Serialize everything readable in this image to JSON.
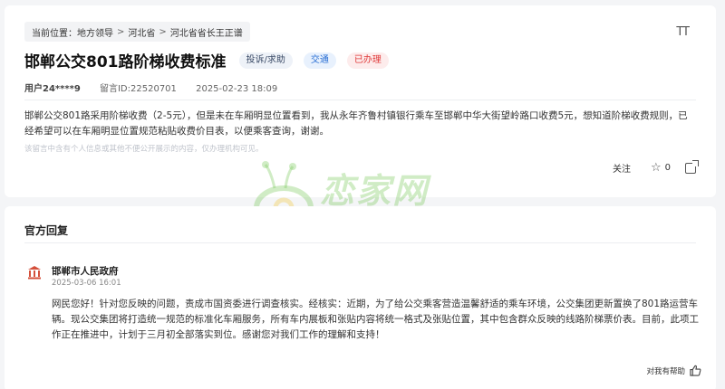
{
  "breadcrumb": {
    "prefix": "当前位置：",
    "items": [
      "地方领导",
      "河北省",
      "河北省省长王正谱"
    ],
    "separator": ">"
  },
  "font_toggle": "TT",
  "message": {
    "title": "邯郸公交801路阶梯收费标准",
    "tags": {
      "category": "投诉/求助",
      "type": "交通",
      "status": "已办理"
    },
    "user": "用户24****9",
    "message_id": "留言ID:22520701",
    "time": "2025-02-23 18:09",
    "content": "邯郸公交801路采用阶梯收费（2-5元），但是未在车厢明显位置看到，我从永年齐鲁村镇银行乘车至邯郸中华大街望岭路口收费5元，想知道阶梯收费规则，已经希望可以在车厢明显位置规范粘贴收费价目表，以便乘客查询，谢谢。",
    "notice": "该留言中含有个人信息或其他不便公开展示的内容，仅办理机构可见。",
    "actions": {
      "follow": "关注",
      "star_count": "0"
    }
  },
  "watermark": {
    "text": "恋家网",
    "url": "www.Ljia.com"
  },
  "reply": {
    "section_title": "官方回复",
    "org": "邯郸市人民政府",
    "date": "2025-03-06 16:01",
    "content": "网民您好！针对您反映的问题，责成市国资委进行调查核实。经核实：近期，为了给公交乘客营造温馨舒适的乘车环境，公交集团更新置换了801路运营车辆。现公交集团将打造统一规范的标准化车厢服务，所有车内展板和张贴内容将统一格式及张贴位置，其中包含群众反映的线路阶梯票价表。目前，此项工作正在推进中，计划于三月初全部落实到位。感谢您对我们工作的理解和支持！",
    "helpful": "对我有帮助"
  },
  "colors": {
    "status_red": "#e03a3a",
    "type_blue": "#2a6fd4",
    "watermark_green": "#78c85a"
  }
}
